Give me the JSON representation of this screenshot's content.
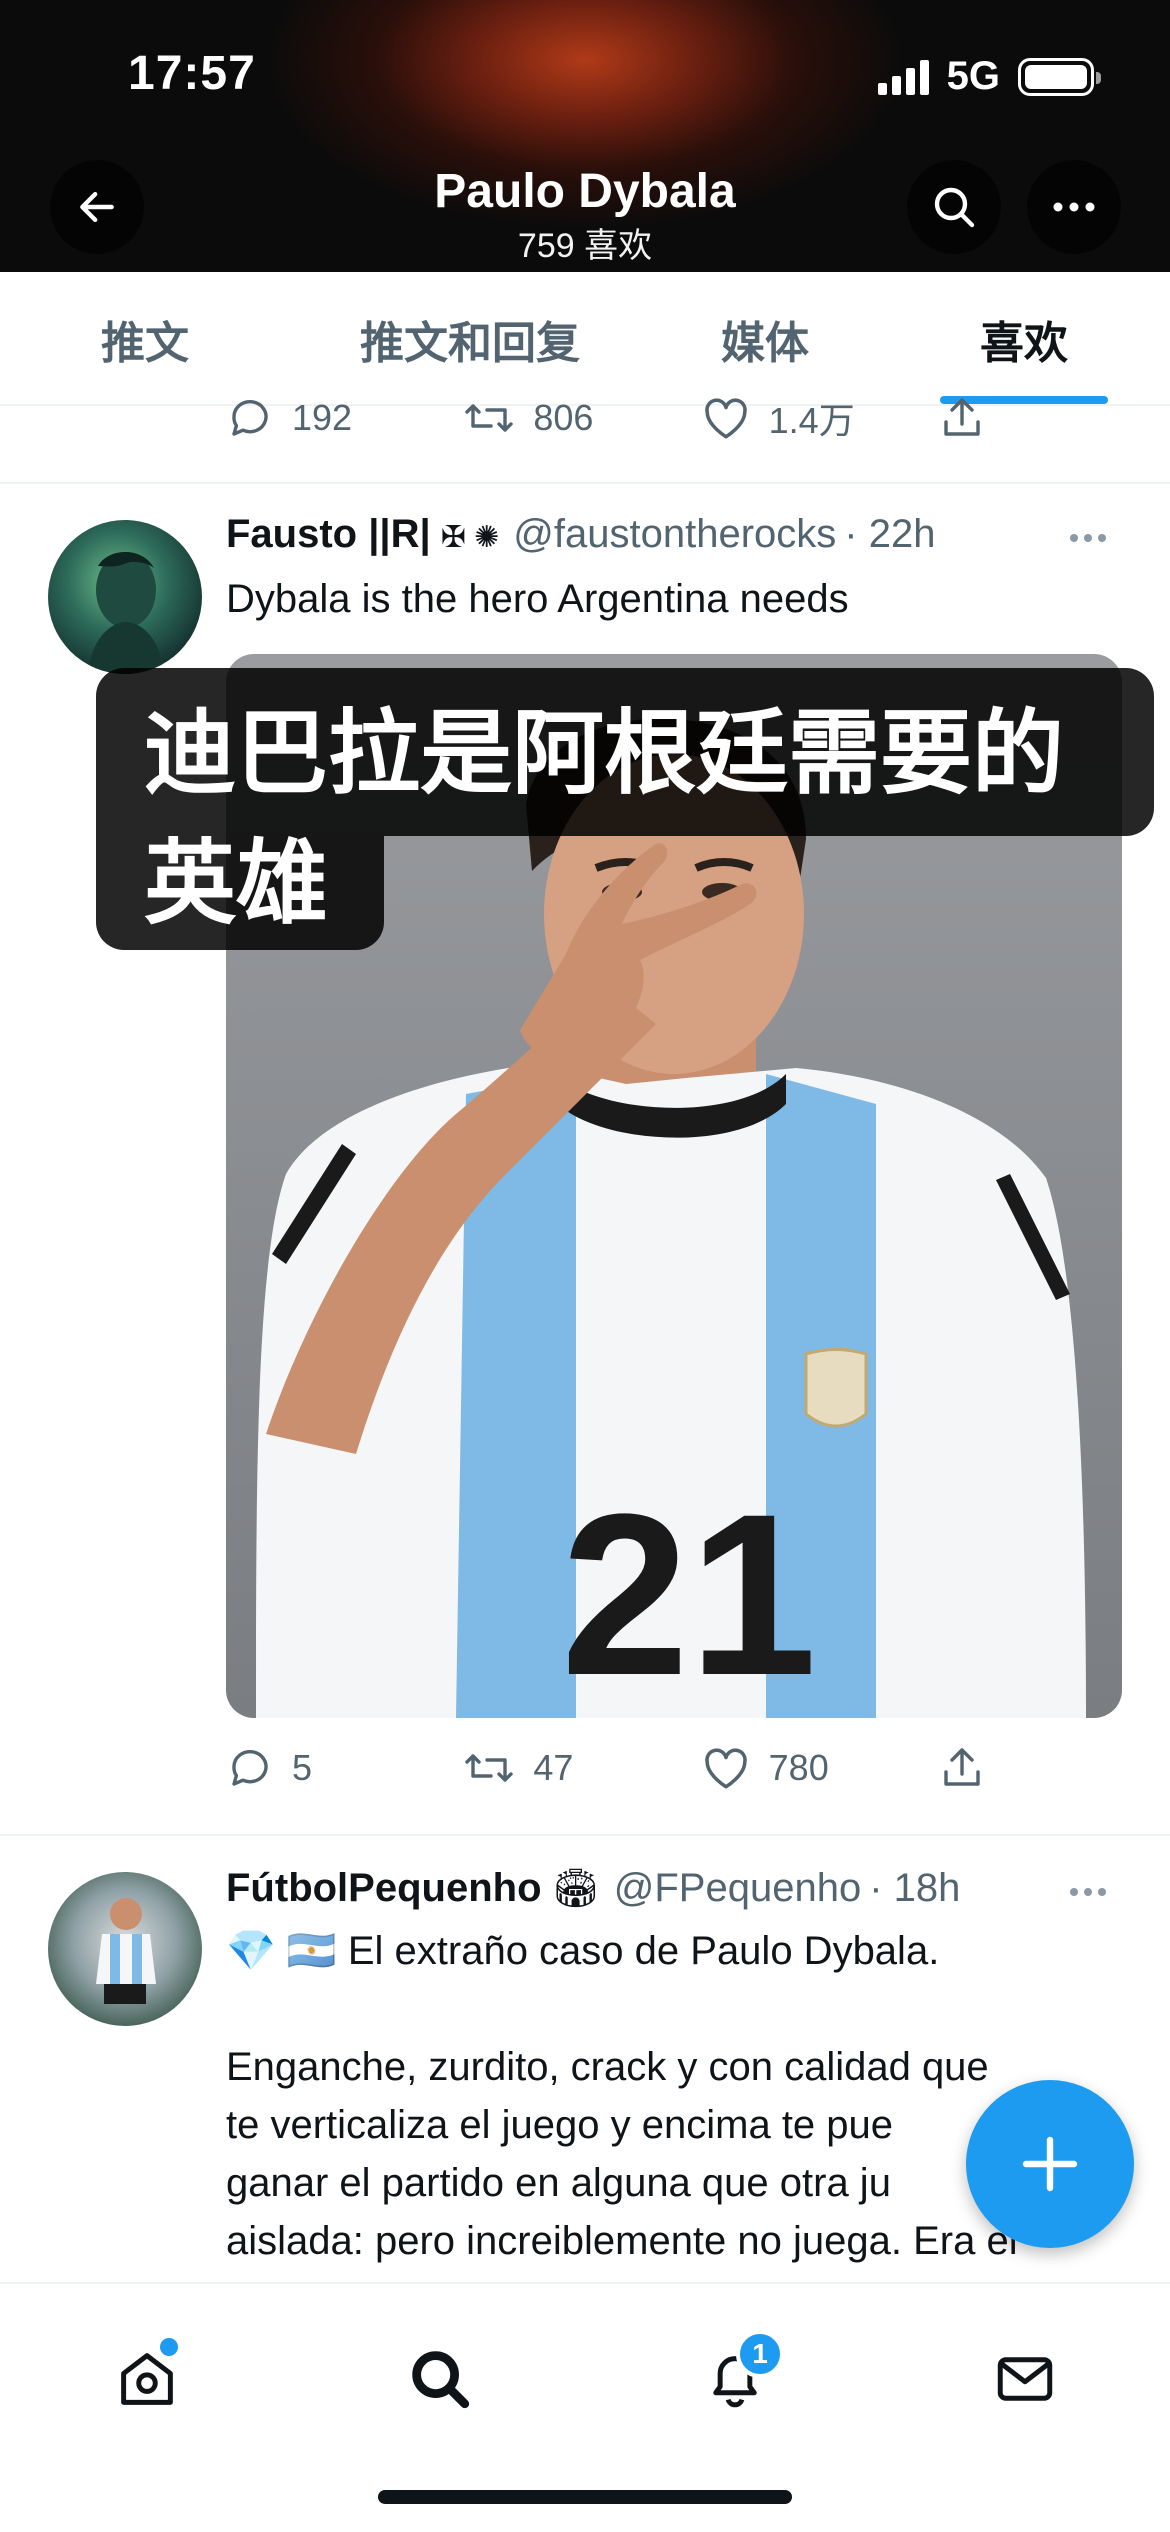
{
  "status_bar": {
    "time": "17:57",
    "network": "5G"
  },
  "header": {
    "title": "Paulo Dybala",
    "subtitle": "759 喜欢"
  },
  "tabs": [
    {
      "label": "推文"
    },
    {
      "label": "推文和回复"
    },
    {
      "label": "媒体"
    },
    {
      "label": "喜欢"
    }
  ],
  "active_tab": "喜欢",
  "previous_tweet": {
    "replies": "192",
    "retweets": "806",
    "likes": "1.4万"
  },
  "tweets": [
    {
      "name": "Fausto ||R|",
      "badges": "✠ ✺",
      "handle": "@faustontherocks",
      "time": "· 22h",
      "text": "Dybala is the hero Argentina needs",
      "jersey_number": "21",
      "replies": "5",
      "retweets": "47",
      "likes": "780"
    },
    {
      "name": "FútbolPequenho",
      "badges": "🏟",
      "handle": "@FPequenho",
      "time": "· 18h",
      "text": "💎 🇦🇷 El extraño caso de Paulo Dybala.\n\nEnganche, zurdito, crack y con calidad que\nte verticaliza el juego y encima te pue\nganar el partido en alguna que otra ju\naislada: pero increiblemente no juega. Era el"
    }
  ],
  "caption": {
    "line1": "迪巴拉是阿根廷需要的",
    "line2": "英雄"
  },
  "bottom_nav": {
    "notification_count": "1"
  },
  "colors": {
    "accent": "#1d9bf0",
    "text": "#0f1419",
    "muted": "#536471"
  }
}
